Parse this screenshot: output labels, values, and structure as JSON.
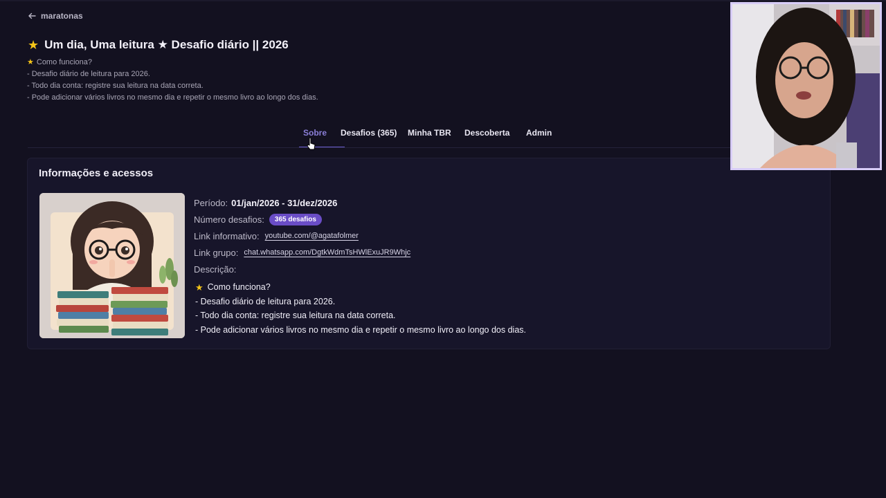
{
  "nav": {
    "back_label": "maratonas"
  },
  "page": {
    "title": "Um dia, Uma leitura ★ Desafio diário || 2026"
  },
  "intro": {
    "heading": "Como funciona?",
    "lines": [
      "- Desafio diário de leitura para 2026.",
      "- Todo dia conta: registre sua leitura na data correta.",
      "- Pode adicionar vários livros no mesmo dia e repetir o mesmo livro ao longo dos dias."
    ]
  },
  "tabs": [
    {
      "label": "Sobre",
      "active": true
    },
    {
      "label": "Desafios (365)",
      "active": false
    },
    {
      "label": "Minha TBR",
      "active": false
    },
    {
      "label": "Descoberta",
      "active": false
    },
    {
      "label": "Admin",
      "active": false
    }
  ],
  "card": {
    "title": "Informações e acessos",
    "periodo_label": "Período:",
    "periodo_value": "01/jan/2026 - 31/dez/2026",
    "numero_label": "Número desafios:",
    "numero_badge": "365 desafios",
    "link_info_label": "Link informativo:",
    "link_info_value": "youtube.com/@agatafolmer",
    "link_grupo_label": "Link grupo:",
    "link_grupo_value": "chat.whatsapp.com/DgtkWdmTsHWlExuJR9Whjc",
    "descricao_label": "Descrição:",
    "descricao_heading": "Como funciona?",
    "descricao_lines": [
      "- Desafio diário de leitura para 2026.",
      "- Todo dia conta: registre sua leitura na data correta.",
      "- Pode adicionar vários livros no mesmo dia e repetir o mesmo livro ao longo dos dias."
    ]
  },
  "colors": {
    "accent": "#6a4dc6",
    "star": "#f5c518",
    "background": "#131120"
  },
  "icons": [
    "arrow-left-icon",
    "star-icon",
    "cursor-icon"
  ]
}
